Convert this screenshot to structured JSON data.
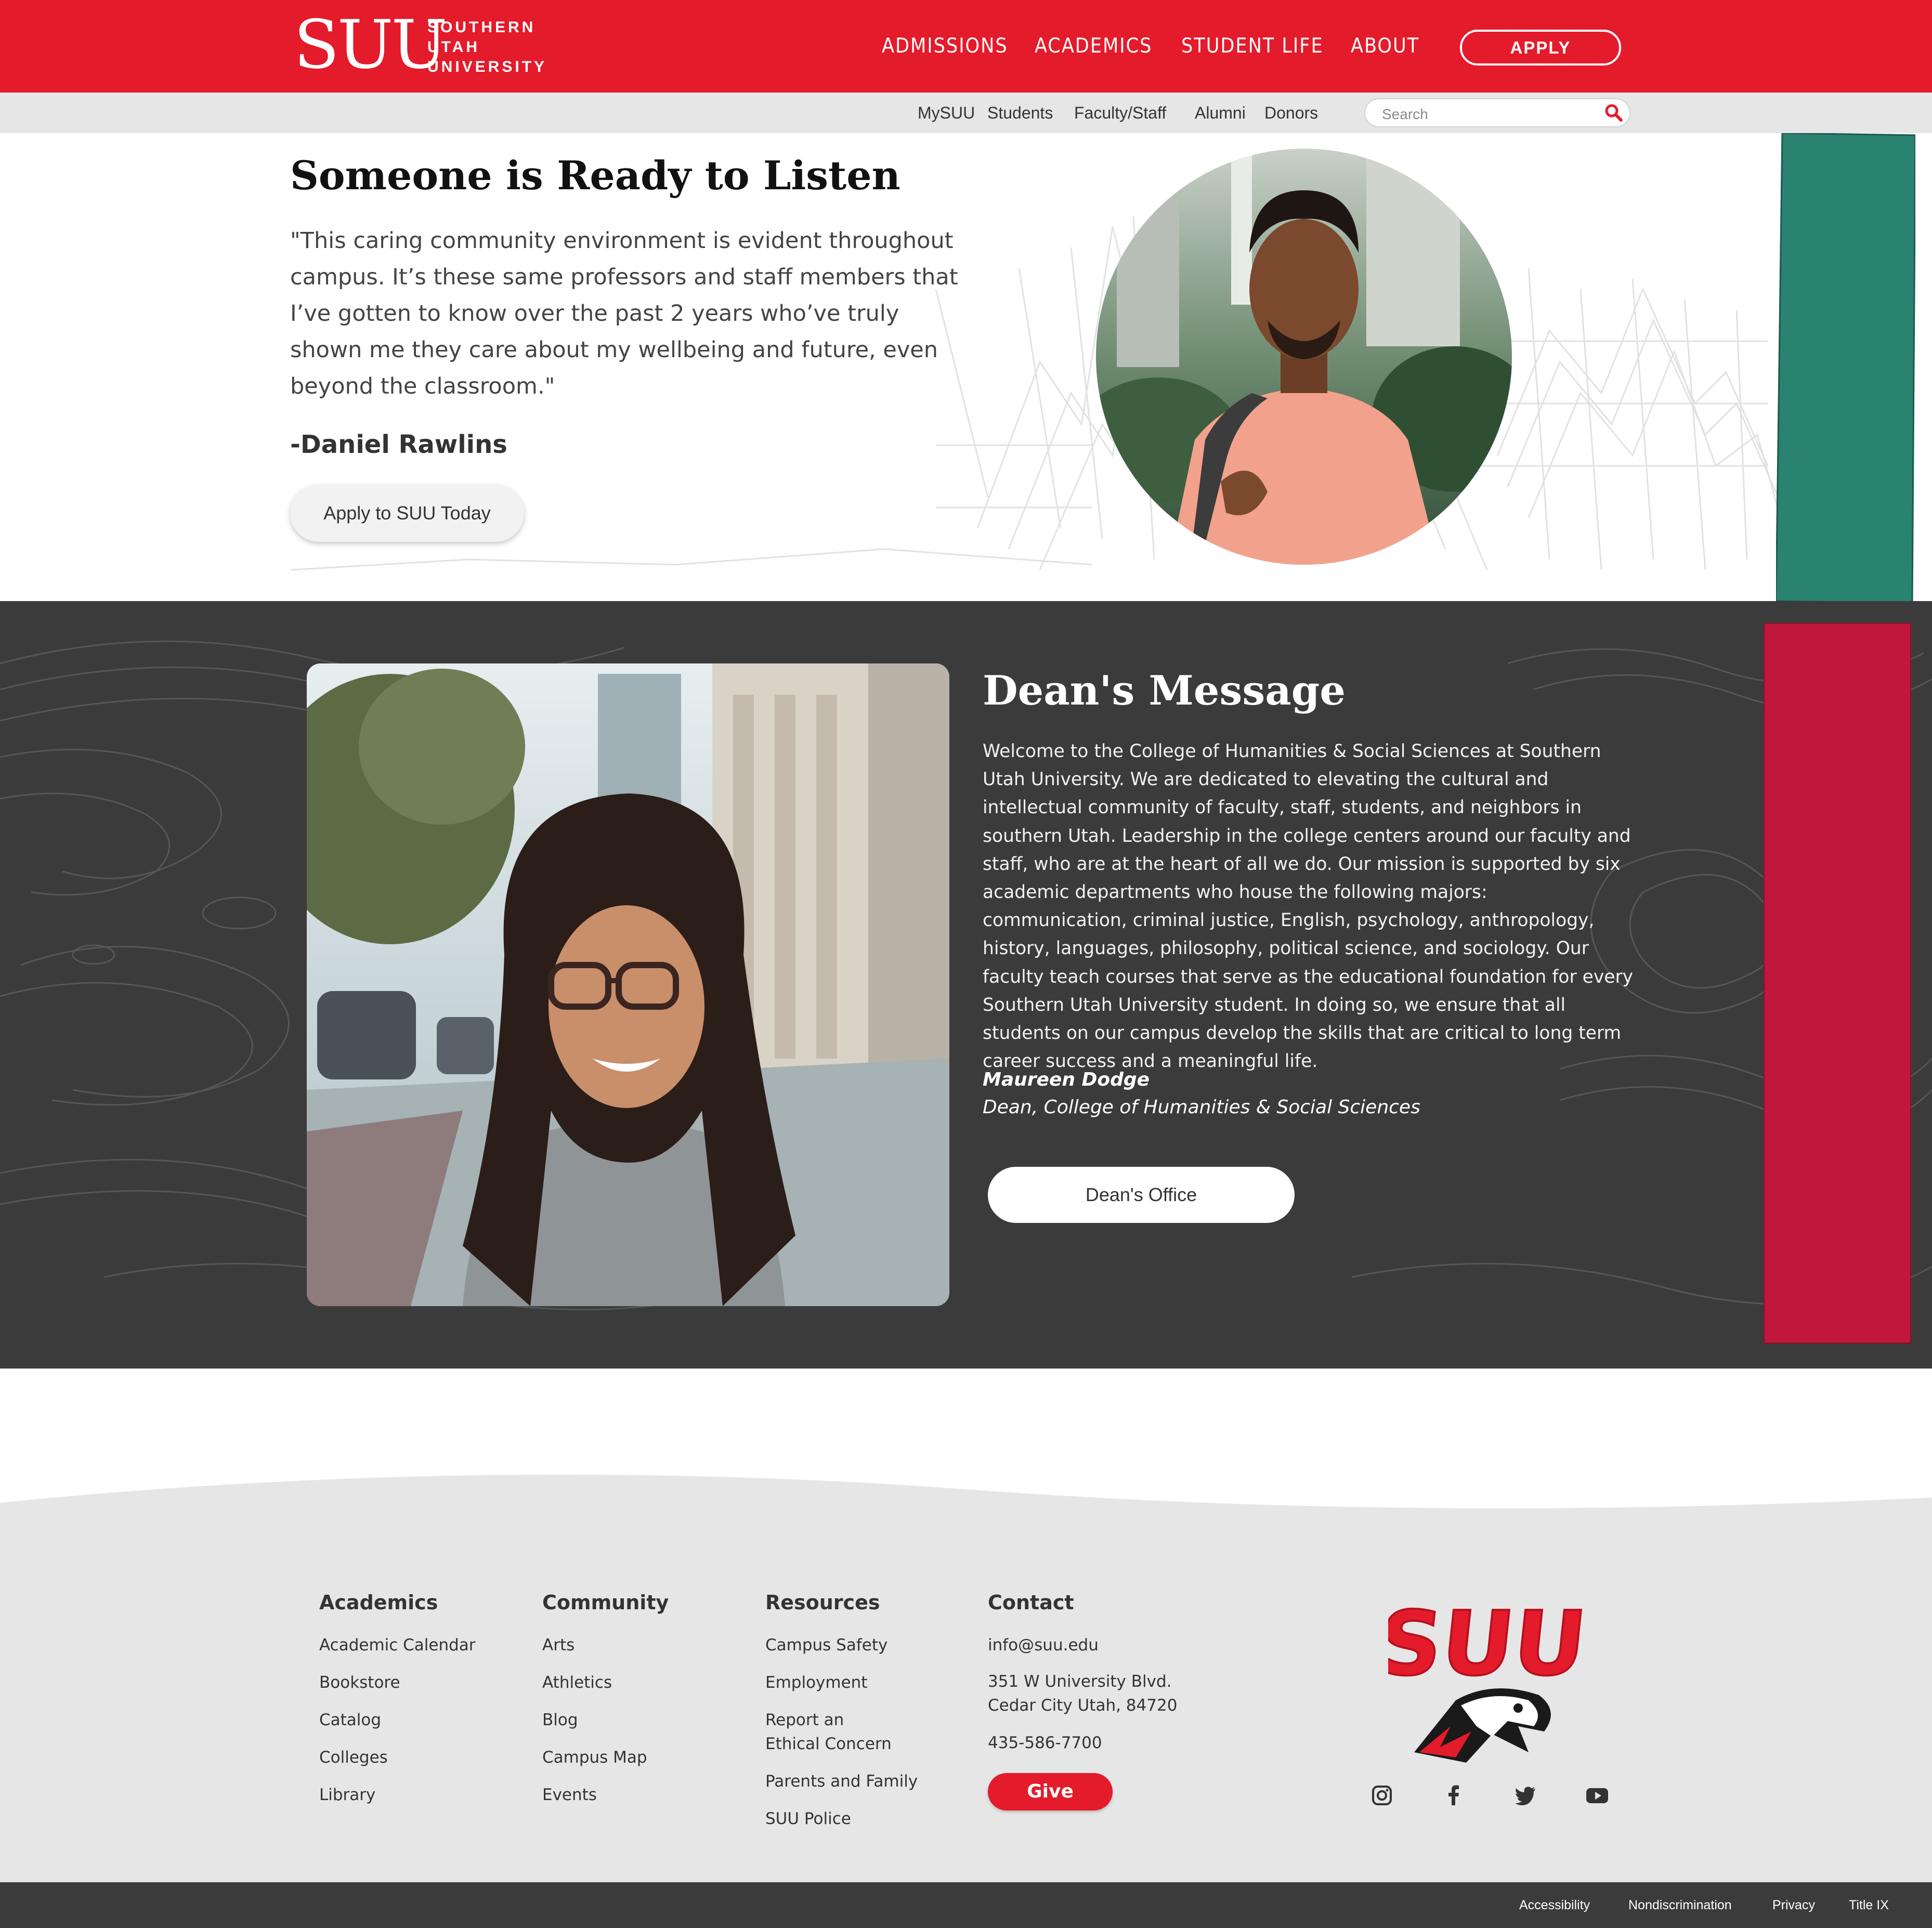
{
  "header": {
    "logo_mark": "SUU",
    "logo_words": [
      "SOUTHERN",
      "UTAH",
      "UNIVERSITY"
    ],
    "nav": [
      "ADMISSIONS",
      "ACADEMICS",
      "STUDENT LIFE",
      "ABOUT"
    ],
    "apply_label": "APPLY",
    "brand_color": "#e41b2b"
  },
  "utility": {
    "links": [
      "MySUU",
      "Students",
      "Faculty/Staff",
      "Alumni",
      "Donors"
    ],
    "search_placeholder": "Search",
    "search_icon": "magnifier-icon"
  },
  "testimonial": {
    "heading": "Someone is Ready to Listen",
    "quote": "\"This caring community environment is evident throughout campus. It’s these same professors and staff members that I’ve gotten to know over the past 2 years who’ve truly shown me they care about my wellbeing and future, even beyond the classroom.\"",
    "author": "-Daniel Rawlins",
    "button_label": "Apply to SUU Today",
    "accent_color": "#2a8270"
  },
  "dean": {
    "heading": "Dean's Message",
    "body": "Welcome to the College of Humanities & Social Sciences at Southern Utah University. We are dedicated to elevating the cultural and intellectual community of faculty, staff, students, and neighbors in southern Utah. Leadership in the college centers around our faculty and staff, who are at the heart of all we do. Our mission is supported by six academic departments who house the following majors: communication, criminal justice, English, psychology, anthropology, history, languages, philosophy, political science, and sociology. Our faculty teach courses that serve as the educational foundation for every Southern Utah University student. In doing so, we ensure that all students on our campus develop the skills that are critical to long term career success and a meaningful life.",
    "name": "Maureen Dodge",
    "title": "Dean, College of Humanities & Social Sciences",
    "button_label": "Dean's Office",
    "accent_color": "#c1173d"
  },
  "footer": {
    "columns": [
      {
        "heading": "Academics",
        "links": [
          "Academic Calendar",
          "Bookstore",
          "Catalog",
          "Colleges",
          "Library"
        ]
      },
      {
        "heading": "Community",
        "links": [
          "Arts",
          "Athletics",
          "Blog",
          "Campus Map",
          "Events"
        ]
      },
      {
        "heading": "Resources",
        "links": [
          "Campus Safety",
          "Employment",
          "Report an",
          "Ethical Concern",
          "Parents and Family",
          "SUU Police"
        ]
      }
    ],
    "contact": {
      "heading": "Contact",
      "email": "info@suu.edu",
      "address_line1": "351 W University Blvd.",
      "address_line2": "Cedar City Utah, 84720",
      "phone": "435-586-7700",
      "give_label": "Give"
    },
    "athletic_logo_text": "SUU",
    "social_icons": [
      "instagram-icon",
      "facebook-icon",
      "twitter-icon",
      "youtube-icon"
    ],
    "bottom_links": [
      "Accessibility",
      "Nondiscrimination",
      "Privacy",
      "Title IX"
    ]
  }
}
